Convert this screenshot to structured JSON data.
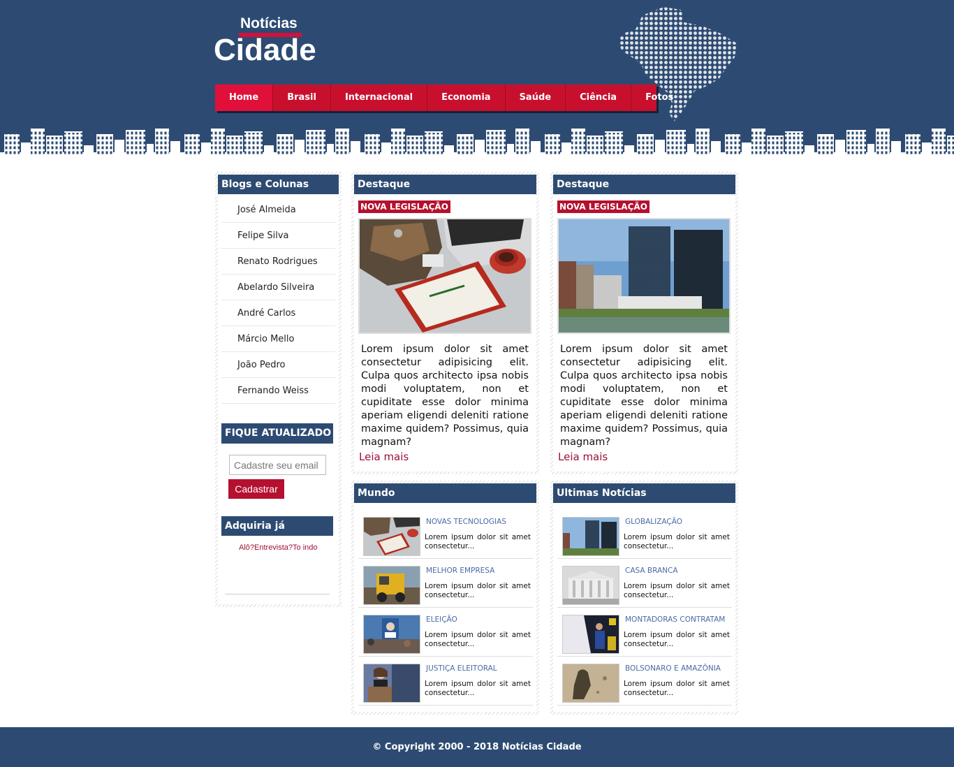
{
  "logo": {
    "small": "Notícias",
    "big": "Cidade"
  },
  "nav": [
    {
      "label": "Home"
    },
    {
      "label": "Brasil"
    },
    {
      "label": "Internacional"
    },
    {
      "label": "Economia"
    },
    {
      "label": "Saúde"
    },
    {
      "label": "Ciência"
    },
    {
      "label": "Fotos"
    }
  ],
  "sidebar": {
    "blogs_title": "Blogs e Colunas",
    "blogs": [
      "José Almeida",
      "Felipe Silva",
      "Renato Rodrigues",
      "Abelardo Silveira",
      "André Carlos",
      "Márcio Mello",
      "João Pedro",
      "Fernando Weiss"
    ],
    "newsletter_title": "FIQUE ATUALIZADO",
    "email_placeholder": "Cadastre seu email",
    "subscribe_label": "Cadastrar",
    "adquira_title": "Adquiria já",
    "adquira_text": "Alô?Entrevista?To indo"
  },
  "destaques": [
    {
      "title": "Destaque",
      "tag": "NOVA LEGISLAÇÃO",
      "text": "Lorem ipsum dolor sit amet consectetur adipisicing elit. Culpa quos architecto ipsa nobis modi voluptatem, non et cupiditate esse dolor minima aperiam eligendi deleniti ratione maxime quidem? Possimus, quia magnam?",
      "more": "Leia mais"
    },
    {
      "title": "Destaque",
      "tag": "NOVA LEGISLAÇÃO",
      "text": "Lorem ipsum dolor sit amet consectetur adipisicing elit. Culpa quos architecto ipsa nobis modi voluptatem, non et cupiditate esse dolor minima aperiam eligendi deleniti ratione maxime quidem? Possimus, quia magnam?",
      "more": "Leia mais"
    }
  ],
  "mundo": {
    "title": "Mundo",
    "items": [
      {
        "title": "NOVAS TECNOLOGIAS",
        "text": "Lorem ipsum dolor sit amet consectetur..."
      },
      {
        "title": "MELHOR EMPRESA",
        "text": "Lorem ipsum dolor sit amet consectetur..."
      },
      {
        "title": "ELEIÇÃO",
        "text": "Lorem ipsum dolor sit amet consectetur..."
      },
      {
        "title": "JUSTIÇA ELEITORAL",
        "text": "Lorem ipsum dolor sit amet consectetur..."
      }
    ]
  },
  "ultimas": {
    "title": "Ultimas Notícias",
    "items": [
      {
        "title": "GLOBALIZAÇÃO",
        "text": "Lorem ipsum dolor sit amet consectetur..."
      },
      {
        "title": "CASA BRANCA",
        "text": "Lorem ipsum dolor sit amet consectetur..."
      },
      {
        "title": "MONTADORAS CONTRATAM",
        "text": "Lorem ipsum dolor sit amet consectetur..."
      },
      {
        "title": "BOLSONARO E AMAZÔNIA",
        "text": "Lorem ipsum dolor sit amet consectetur..."
      }
    ]
  },
  "footer": {
    "copyright": "© Copyright 2000 - 2018 Notícias Cidade"
  }
}
